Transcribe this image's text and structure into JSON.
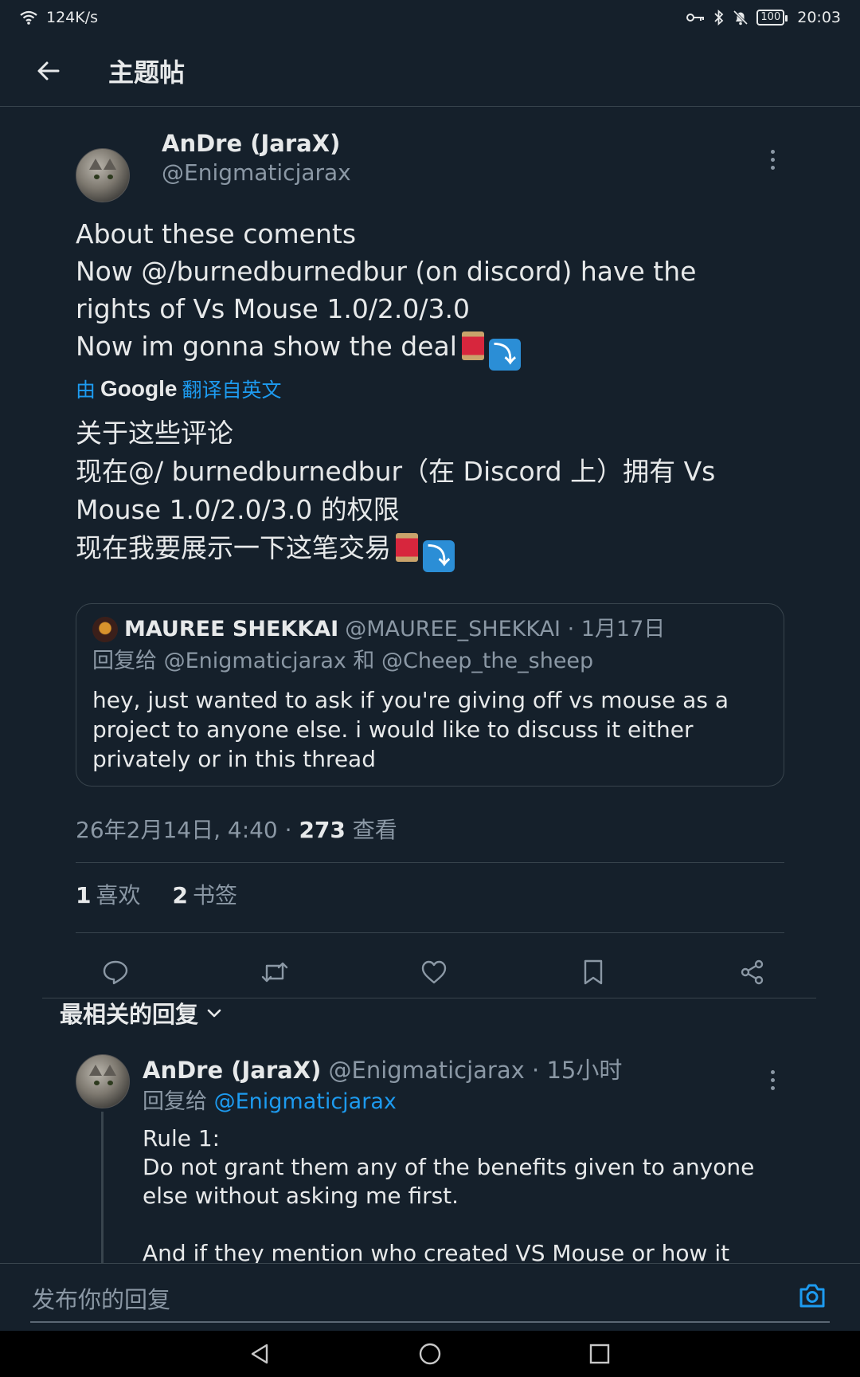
{
  "status_bar": {
    "speed": "124K/s",
    "battery": "100",
    "time": "20:03"
  },
  "header": {
    "title": "主题帖"
  },
  "tweet": {
    "author_name": "AnDre (JaraX)",
    "author_handle": "@Enigmaticjarax",
    "text_lines": [
      "About these coments",
      "Now @/burnedburnedbur (on discord) have the",
      "rights of Vs Mouse 1.0/2.0/3.0",
      "Now im gonna show the deal"
    ],
    "translate_prefix": "由",
    "translate_brand": "Google",
    "translate_suffix": "翻译自英文",
    "translated_lines": [
      "关于这些评论",
      "现在@/ burnedburnedbur（在 Discord 上）拥有 Vs",
      "Mouse 1.0/2.0/3.0 的权限",
      "现在我要展示一下这笔交易"
    ],
    "quote": {
      "name": "MAUREE SHEKKAI",
      "handle_date": "@MAUREE_SHEKKAI · 1月17日",
      "reply_to": "回复给 @Enigmaticjarax 和 @Cheep_the_sheep",
      "text_lines": [
        "hey, just wanted to ask if you're giving off vs mouse as a",
        "project to anyone else. i would like to discuss it either",
        "privately or in this thread"
      ]
    },
    "timestamp": "26年2月14日, 4:40 · ",
    "views_count": "273",
    "views_label": " 查看",
    "likes_count": "1",
    "likes_label": "喜欢",
    "bookmarks_count": "2",
    "bookmarks_label": "书签"
  },
  "replies_sort": "最相关的回复",
  "reply": {
    "author_name": "AnDre (JaraX)",
    "handle_time": " @Enigmaticjarax · 15小时",
    "reply_to_prefix": "回复给 ",
    "reply_to_handle": "@Enigmaticjarax",
    "text_lines": [
      "Rule 1:",
      "Do not grant them any of the benefits given to anyone",
      "else without asking me first.",
      "",
      "And if they mention who created VS Mouse or how it"
    ]
  },
  "compose": {
    "placeholder": "发布你的回复"
  },
  "colors": {
    "background": "#15202b",
    "accent": "#1d9bf0",
    "muted": "#8b98a5",
    "divider": "#38444d"
  }
}
